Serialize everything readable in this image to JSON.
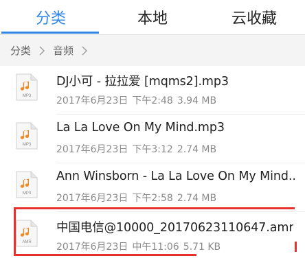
{
  "tabs": [
    {
      "label": "分类",
      "active": true
    },
    {
      "label": "本地",
      "active": false
    },
    {
      "label": "云收藏",
      "active": false
    }
  ],
  "breadcrumb": [
    "分类",
    "音频"
  ],
  "accent_color": "#2f86e6",
  "highlight_color": "#e8302f",
  "files": [
    {
      "name": "DJ小可 - 拉拉爱 [mqms2].mp3",
      "date": "2017年6月23日",
      "time": "下午2:48",
      "size": "3.94 MB",
      "type": "MP3",
      "icon": "music-file-icon"
    },
    {
      "name": "La La Love On My Mind.mp3",
      "date": "2017年6月23日",
      "time": "下午3:12",
      "size": "2.74 MB",
      "type": "MP3",
      "icon": "music-file-icon"
    },
    {
      "name": "Ann Winsborn - La La Love On My Mind....",
      "date": "2017年6月23日",
      "time": "下午2:58",
      "size": "2.74 MB",
      "type": "MP3",
      "icon": "music-file-icon"
    },
    {
      "name": "中国电信@10000_20170623110647.amr",
      "date": "2017年6月23日",
      "time": "中午11:06",
      "size": "5.71 KB",
      "type": "AMR",
      "icon": "music-file-icon"
    }
  ]
}
